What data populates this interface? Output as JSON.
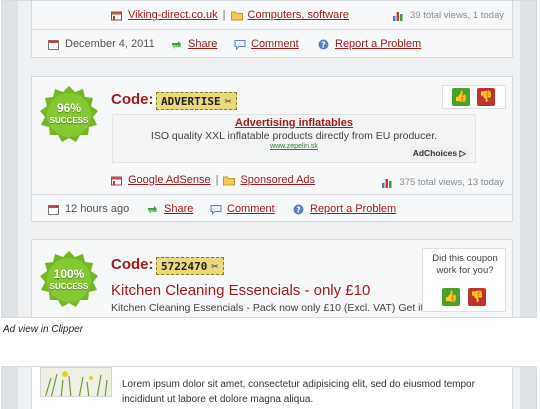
{
  "top_card": {
    "store": "Viking-direct.co.uk",
    "separator": "|",
    "category": "Computers, software",
    "views": "39 total views, 1 today",
    "date": "December 4, 2011",
    "share": "Share",
    "comment": "Comment",
    "report": "Report a Problem"
  },
  "ad_card": {
    "success_pct": "96%",
    "success_label": "SUCCESS",
    "code_label": "Code:",
    "code": "ADVERTISE",
    "ad_title": "Advertising inflatables",
    "ad_desc": "ISO quality XXL inflatable products directly from EU producer.",
    "ad_url": "www.zepelin.sk",
    "adchoices": "AdChoices",
    "store": "Google AdSense",
    "separator": "|",
    "category": "Sponsored Ads",
    "views": "375 total views, 13 today",
    "date": "12 hours ago",
    "share": "Share",
    "comment": "Comment",
    "report": "Report a Problem"
  },
  "coupon_card": {
    "success_pct": "100%",
    "success_label": "SUCCESS",
    "code_label": "Code:",
    "code": "5722470",
    "title": "Kitchen Cleaning Essencials - only £10",
    "desc": "Kitchen Cleaning Essencials - Pack now only £10 (Excl. VAT) Get it",
    "vote_question": "Did this coupon work for you?"
  },
  "caption": "Ad view in Clipper",
  "bottom_snippet": {
    "lorem": "Lorem ipsum dolor sit amet, consectetur adipisicing elit, sed do eiusmod tempor incididunt ut labore et dolore magna aliqua."
  },
  "colors": {
    "accent_red": "#a01c1c",
    "success_green": "#6fb521",
    "vote_up": "#49a12c",
    "vote_down": "#c0332b",
    "code_yellow": "#e8d97e"
  },
  "icons": [
    "store-icon",
    "folder-icon",
    "chart-icon",
    "calendar-icon",
    "share-icon",
    "comment-icon",
    "help-icon",
    "scissors-icon",
    "thumbs-up-icon",
    "thumbs-down-icon"
  ]
}
